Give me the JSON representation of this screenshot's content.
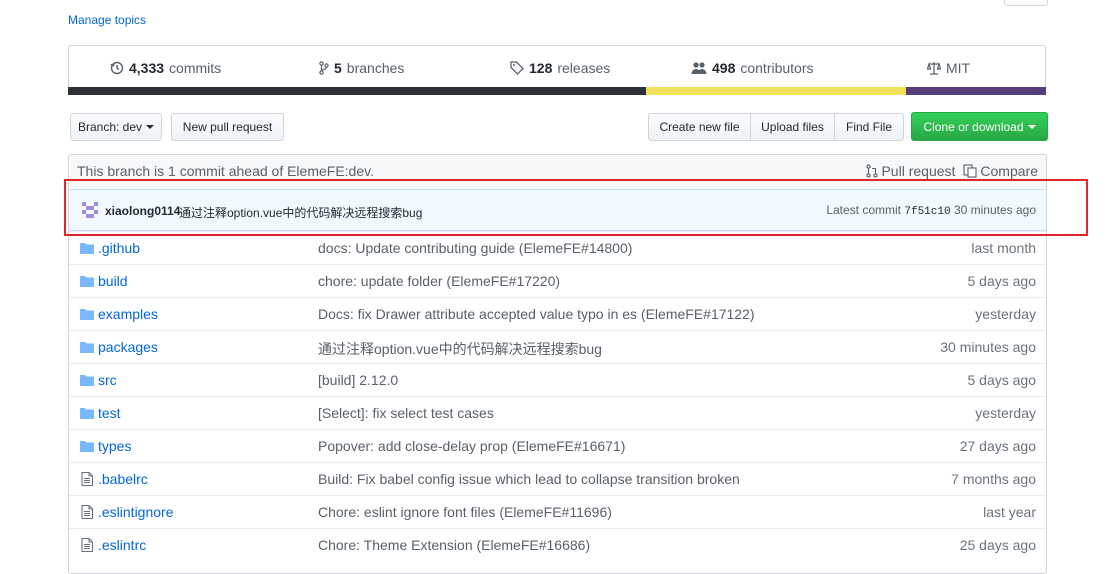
{
  "topics": {
    "manage_label": "Manage topics"
  },
  "summary": {
    "commits": {
      "count": "4,333",
      "label": "commits"
    },
    "branches": {
      "count": "5",
      "label": "branches"
    },
    "releases": {
      "count": "128",
      "label": "releases"
    },
    "contributors": {
      "count": "498",
      "label": "contributors"
    },
    "license": {
      "label": "MIT"
    }
  },
  "language_colors": [
    "#2b3137",
    "#f1e05a",
    "#563d7c"
  ],
  "toolbar": {
    "branch_label": "Branch: dev",
    "new_pr_label": "New pull request",
    "create_file_label": "Create new file",
    "upload_label": "Upload files",
    "find_file_label": "Find File",
    "clone_label": "Clone or download"
  },
  "branch_info": {
    "message": "This branch is 1 commit ahead of ElemeFE:dev.",
    "pull_request_label": "Pull request",
    "compare_label": "Compare"
  },
  "latest_commit": {
    "author": "xiaolong0114",
    "message": "通过注释option.vue中的代码解决远程搜索bug",
    "prefix": "Latest commit",
    "sha": "7f51c10",
    "age": "30 minutes ago"
  },
  "files": [
    {
      "type": "dir",
      "name": ".github",
      "message": "docs: Update contributing guide (ElemeFE#14800)",
      "age": "last month"
    },
    {
      "type": "dir",
      "name": "build",
      "message": "chore: update folder (ElemeFE#17220)",
      "age": "5 days ago"
    },
    {
      "type": "dir",
      "name": "examples",
      "message": "Docs: fix Drawer attribute accepted value typo in es (ElemeFE#17122)",
      "age": "yesterday"
    },
    {
      "type": "dir",
      "name": "packages",
      "message": "通过注释option.vue中的代码解决远程搜索bug",
      "age": "30 minutes ago"
    },
    {
      "type": "dir",
      "name": "src",
      "message": "[build] 2.12.0",
      "age": "5 days ago"
    },
    {
      "type": "dir",
      "name": "test",
      "message": "[Select]: fix select test cases",
      "age": "yesterday"
    },
    {
      "type": "dir",
      "name": "types",
      "message": "Popover: add close-delay prop (ElemeFE#16671)",
      "age": "27 days ago"
    },
    {
      "type": "file",
      "name": ".babelrc",
      "message": "Build: Fix babel config issue which lead to collapse transition broken",
      "age": "7 months ago"
    },
    {
      "type": "file",
      "name": ".eslintignore",
      "message": "Chore: eslint ignore font files (ElemeFE#11696)",
      "age": "last year"
    },
    {
      "type": "file",
      "name": ".eslintrc",
      "message": "Chore: Theme Extension (ElemeFE#16686)",
      "age": "25 days ago"
    }
  ],
  "annotation_color": "#e0262c"
}
